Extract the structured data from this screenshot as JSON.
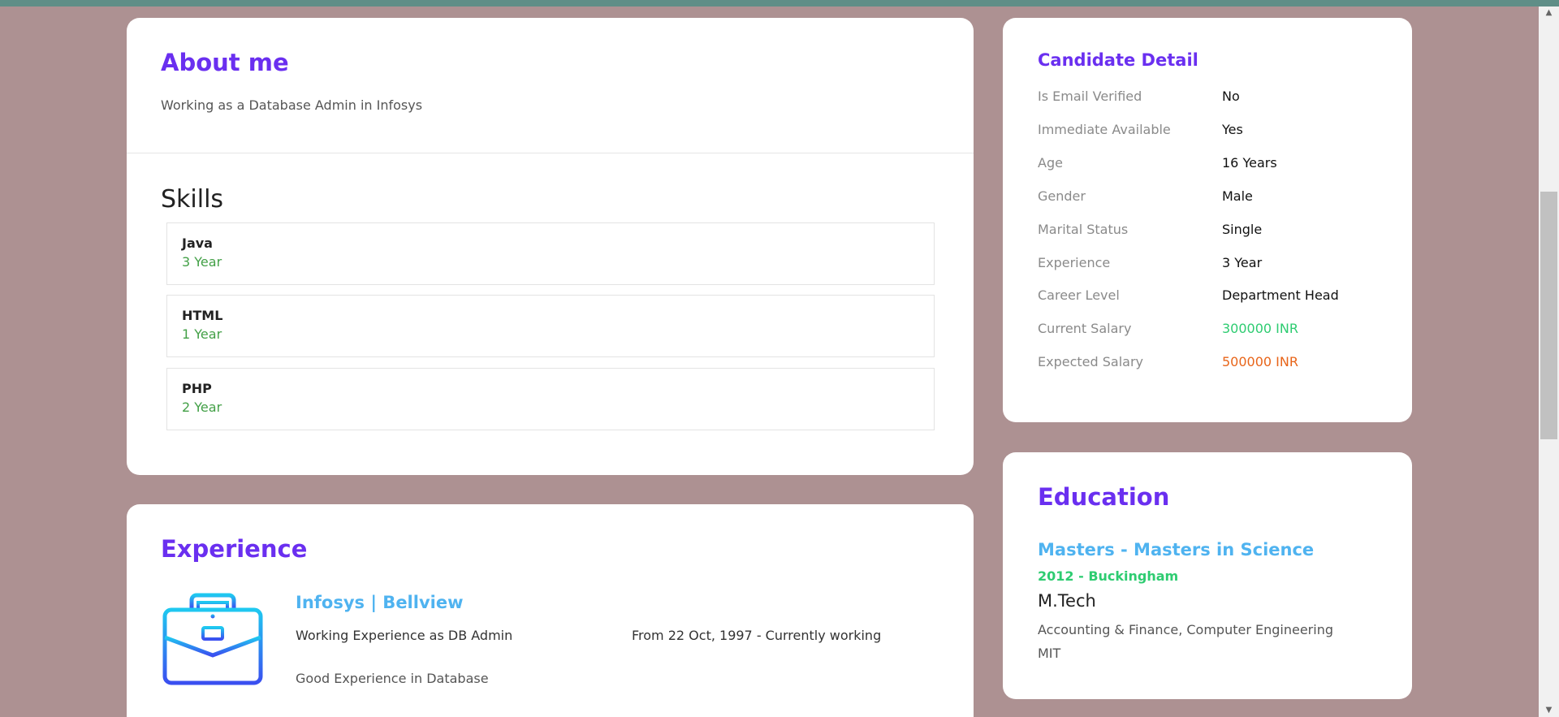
{
  "about": {
    "title": "About me",
    "text": "Working as a Database Admin in Infosys"
  },
  "skills": {
    "title": "Skills",
    "items": [
      {
        "name": "Java",
        "years": "3 Year"
      },
      {
        "name": "HTML",
        "years": "1 Year"
      },
      {
        "name": "PHP",
        "years": "2 Year"
      }
    ]
  },
  "experience": {
    "title": "Experience",
    "icon": "briefcase-icon",
    "company": "Infosys | Bellview",
    "role": "Working Experience as DB Admin",
    "dates": "From 22 Oct, 1997 - Currently working",
    "description": "Good Experience in Database"
  },
  "candidate": {
    "title": "Candidate Detail",
    "rows": [
      {
        "label": "Is Email Verified",
        "value": "No"
      },
      {
        "label": "Immediate Available",
        "value": "Yes"
      },
      {
        "label": "Age",
        "value": "16 Years"
      },
      {
        "label": "Gender",
        "value": "Male"
      },
      {
        "label": "Marital Status",
        "value": "Single"
      },
      {
        "label": "Experience",
        "value": "3 Year"
      },
      {
        "label": "Career Level",
        "value": "Department Head"
      },
      {
        "label": "Current Salary",
        "value": "300000 INR"
      },
      {
        "label": "Expected Salary",
        "value": "500000 INR"
      }
    ]
  },
  "education": {
    "title": "Education",
    "degree": "Masters - Masters in Science",
    "year_place": "2012 - Buckingham",
    "short": "M.Tech",
    "fields": "Accounting & Finance, Computer Engineering",
    "school": "MIT"
  },
  "colors": {
    "background": "#ad9192",
    "heading": "#6a2ff0",
    "accent_blue": "#4fb3f0",
    "green": "#2ecc71",
    "skill_green": "#43a047",
    "orange": "#e8651a"
  }
}
